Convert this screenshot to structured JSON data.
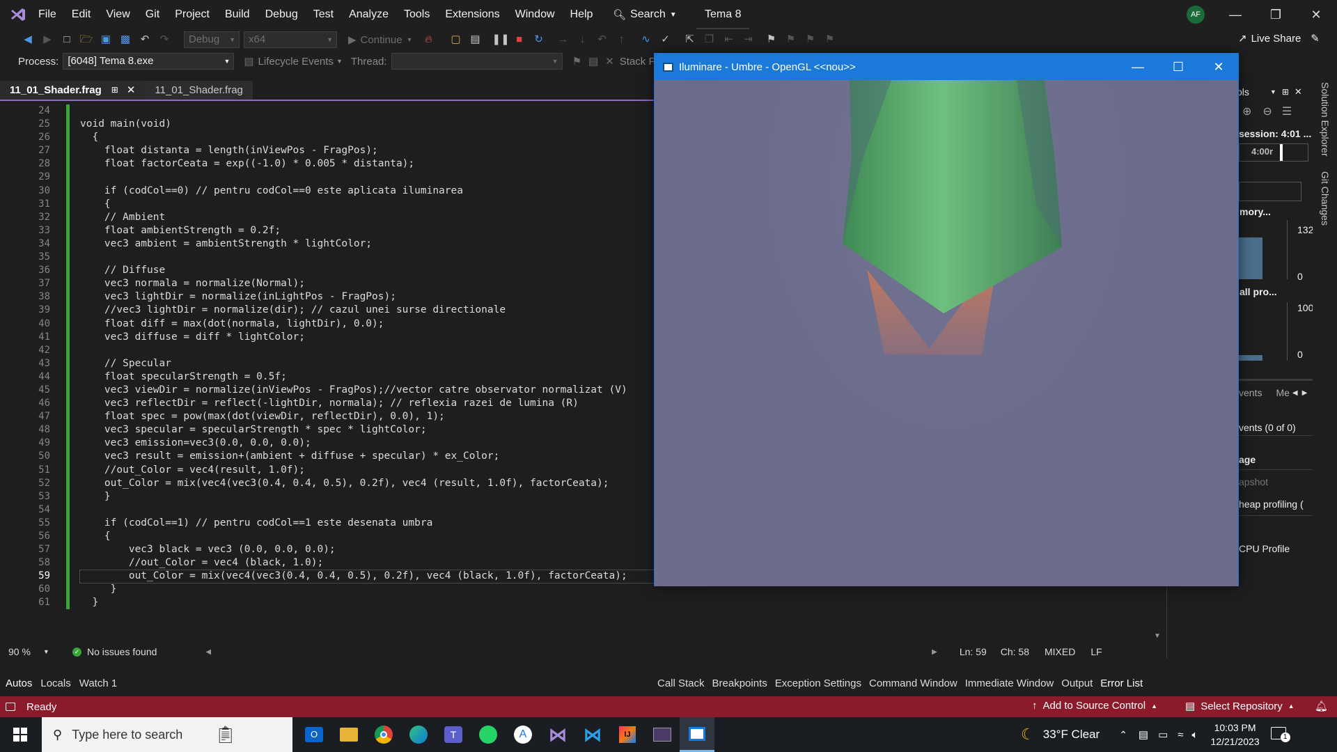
{
  "menubar": {
    "items": [
      "File",
      "Edit",
      "View",
      "Git",
      "Project",
      "Build",
      "Debug",
      "Test",
      "Analyze",
      "Tools",
      "Extensions",
      "Window",
      "Help"
    ],
    "search_label": "Search",
    "project_name": "Tema 8",
    "avatar_initials": "AF"
  },
  "toolbar": {
    "config": "Debug",
    "platform": "x64",
    "continue_label": "Continue",
    "live_share_label": "Live Share"
  },
  "processbar": {
    "process_label": "Process:",
    "process_value": "[6048] Tema 8.exe",
    "lifecycle_label": "Lifecycle Events",
    "thread_label": "Thread:",
    "stack_label": "Stack F"
  },
  "tabs": [
    {
      "label": "11_01_Shader.frag",
      "active": true
    },
    {
      "label": "11_01_Shader.frag",
      "active": false
    }
  ],
  "editor": {
    "current_line": 59,
    "lines": [
      {
        "n": "24",
        "code": ""
      },
      {
        "n": "25",
        "code": "void main(void)"
      },
      {
        "n": "26",
        "code": "  {"
      },
      {
        "n": "27",
        "code": "    float distanta = length(inViewPos - FragPos);"
      },
      {
        "n": "28",
        "code": "    float factorCeata = exp((-1.0) * 0.005 * distanta);"
      },
      {
        "n": "29",
        "code": ""
      },
      {
        "n": "30",
        "code": "    if (codCol==0) // pentru codCol==0 este aplicata iluminarea"
      },
      {
        "n": "31",
        "code": "    {"
      },
      {
        "n": "32",
        "code": "    // Ambient"
      },
      {
        "n": "33",
        "code": "    float ambientStrength = 0.2f;"
      },
      {
        "n": "34",
        "code": "    vec3 ambient = ambientStrength * lightColor;"
      },
      {
        "n": "35",
        "code": ""
      },
      {
        "n": "36",
        "code": "    // Diffuse"
      },
      {
        "n": "37",
        "code": "    vec3 normala = normalize(Normal);"
      },
      {
        "n": "38",
        "code": "    vec3 lightDir = normalize(inLightPos - FragPos);"
      },
      {
        "n": "39",
        "code": "    //vec3 lightDir = normalize(dir); // cazul unei surse directionale"
      },
      {
        "n": "40",
        "code": "    float diff = max(dot(normala, lightDir), 0.0);"
      },
      {
        "n": "41",
        "code": "    vec3 diffuse = diff * lightColor;"
      },
      {
        "n": "42",
        "code": ""
      },
      {
        "n": "43",
        "code": "    // Specular"
      },
      {
        "n": "44",
        "code": "    float specularStrength = 0.5f;"
      },
      {
        "n": "45",
        "code": "    vec3 viewDir = normalize(inViewPos - FragPos);//vector catre observator normalizat (V)"
      },
      {
        "n": "46",
        "code": "    vec3 reflectDir = reflect(-lightDir, normala); // reflexia razei de lumina (R)"
      },
      {
        "n": "47",
        "code": "    float spec = pow(max(dot(viewDir, reflectDir), 0.0), 1);"
      },
      {
        "n": "48",
        "code": "    vec3 specular = specularStrength * spec * lightColor;"
      },
      {
        "n": "49",
        "code": "    vec3 emission=vec3(0.0, 0.0, 0.0);"
      },
      {
        "n": "50",
        "code": "    vec3 result = emission+(ambient + diffuse + specular) * ex_Color;"
      },
      {
        "n": "51",
        "code": "    //out_Color = vec4(result, 1.0f);"
      },
      {
        "n": "52",
        "code": "    out_Color = mix(vec4(vec3(0.4, 0.4, 0.5), 0.2f), vec4 (result, 1.0f), factorCeata);"
      },
      {
        "n": "53",
        "code": "    }"
      },
      {
        "n": "54",
        "code": ""
      },
      {
        "n": "55",
        "code": "    if (codCol==1) // pentru codCol==1 este desenata umbra"
      },
      {
        "n": "56",
        "code": "    {"
      },
      {
        "n": "57",
        "code": "        vec3 black = vec3 (0.0, 0.0, 0.0);"
      },
      {
        "n": "58",
        "code": "        //out_Color = vec4 (black, 1.0);"
      },
      {
        "n": "59",
        "code": "        out_Color = mix(vec4(vec3(0.4, 0.4, 0.5), 0.2f), vec4 (black, 1.0f), factorCeata);"
      },
      {
        "n": "60",
        "code": "     }"
      },
      {
        "n": "61",
        "code": "  }"
      }
    ]
  },
  "editor_status": {
    "zoom": "90 %",
    "issues": "No issues found",
    "ln": "Ln: 59",
    "ch": "Ch: 58",
    "mode": "MIXED",
    "eol": "LF"
  },
  "diag": {
    "tools_label": "ols",
    "session_label": "session: 4:01 ...",
    "time_mark": "4:00r",
    "memory_label": "mory...",
    "mem_max": "132",
    "mem_min": "0",
    "cpu_label": "all pro...",
    "cpu_max": "100",
    "cpu_min": "0",
    "events_tab": "vents",
    "mem_tab": "Me",
    "events_count": "vents (0 of 0)",
    "usage_label": "age",
    "snapshot_label": "apshot",
    "heap_label": "heap profiling (",
    "cpu_profile_label": "CPU Profile"
  },
  "sidestrip": {
    "solution_explorer": "Solution Explorer",
    "git_changes": "Git Changes"
  },
  "glwindow": {
    "title": "Iluminare - Umbre - OpenGL <<nou>>"
  },
  "bottom_left_tabs": [
    "Autos",
    "Locals",
    "Watch 1"
  ],
  "bottom_right_tabs": [
    "Call Stack",
    "Breakpoints",
    "Exception Settings",
    "Command Window",
    "Immediate Window",
    "Output",
    "Error List"
  ],
  "statusbar": {
    "ready": "Ready",
    "add_source": "Add to Source Control",
    "select_repo": "Select Repository",
    "notification_count": "1"
  },
  "taskbar": {
    "search_placeholder": "Type here to search",
    "weather": "33°F  Clear",
    "time": "10:03 PM",
    "date": "12/21/2023"
  },
  "colors": {
    "accent_purple": "#8d6cc4",
    "status_red": "#8b1a2b",
    "gl_title_blue": "#1b7ad9",
    "cone_green": "#5fae6c",
    "cone_orange": "#c47a5c"
  }
}
